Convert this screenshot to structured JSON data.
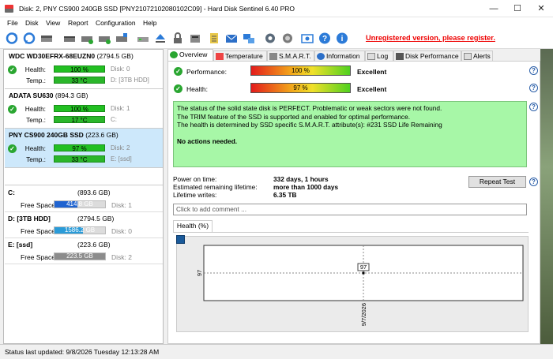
{
  "window": {
    "title": "Disk: 2, PNY CS900 240GB SSD [PNY21072102080102C09]  -  Hard Disk Sentinel 6.40 PRO",
    "minimize": "—",
    "maximize": "☐",
    "close": "✕"
  },
  "menu": [
    "File",
    "Disk",
    "View",
    "Report",
    "Configuration",
    "Help"
  ],
  "toolbar": {
    "icons": [
      "refresh-icon",
      "refresh-all-icon",
      "disk-scan-icon",
      "disk-test-icon",
      "health-icon",
      "eject-icon",
      "lock-icon",
      "device-icon",
      "report-icon",
      "mail-icon",
      "monitor-icon",
      "settings-icon",
      "sound-icon",
      "screenshot-icon",
      "help-icon",
      "info-icon"
    ],
    "unregistered": "Unregistered version, please register."
  },
  "disks": [
    {
      "name": "WDC WD30EFRX-68EUZN0",
      "size": "(2794.5 GB)",
      "health_label": "Health:",
      "health": "100 %",
      "health_pct": 100,
      "disk": "Disk: 0",
      "temp_label": "Temp.:",
      "temp": "33 °C",
      "vol": "D: [3TB HDD]"
    },
    {
      "name": "ADATA SU630",
      "size": "(894.3 GB)",
      "health_label": "Health:",
      "health": "100 %",
      "health_pct": 100,
      "disk": "Disk: 1",
      "temp_label": "Temp.:",
      "temp": "17 °C",
      "vol": "C:"
    },
    {
      "name": "PNY CS900 240GB SSD",
      "size": "(223.6 GB)",
      "health_label": "Health:",
      "health": "97 %",
      "health_pct": 97,
      "disk": "Disk: 2",
      "temp_label": "Temp.:",
      "temp": "33 °C",
      "vol": "E: [ssd]"
    }
  ],
  "volumes": [
    {
      "name": "C:",
      "size": "(893.6 GB)",
      "free_label": "Free Space",
      "free": "414.8 GB",
      "free_pct": 46,
      "disk": "Disk: 1",
      "color": "#1f63d0"
    },
    {
      "name": "D: [3TB HDD]",
      "size": "(2794.5 GB)",
      "free_label": "Free Space",
      "free": "1586.2 GB",
      "free_pct": 57,
      "disk": "Disk: 0",
      "color": "#2a9bd8"
    },
    {
      "name": "E: [ssd]",
      "size": "(223.6 GB)",
      "free_label": "Free Space",
      "free": "223.5 GB",
      "free_pct": 100,
      "disk": "Disk: 2",
      "color": "#8c8c8c"
    }
  ],
  "tabs": [
    "Overview",
    "Temperature",
    "S.M.A.R.T.",
    "Information",
    "Log",
    "Disk Performance",
    "Alerts"
  ],
  "overview": {
    "performance_label": "Performance:",
    "performance": "100 %",
    "performance_pct": 100,
    "performance_rating": "Excellent",
    "health_label": "Health:",
    "health": "97 %",
    "health_pct": 97,
    "health_rating": "Excellent",
    "status_lines": [
      "The status of the solid state disk is PERFECT. Problematic or weak sectors were not found.",
      "The TRIM feature of the SSD is supported and enabled for optimal performance.",
      "The health is determined by SSD specific S.M.A.R.T. attribute(s):  #231 SSD Life Remaining"
    ],
    "actions": "No actions needed.",
    "power_on_label": "Power on time:",
    "power_on": "332 days, 1 hours",
    "remaining_label": "Estimated remaining lifetime:",
    "remaining": "more than 1000 days",
    "writes_label": "Lifetime writes:",
    "writes": "6.35 TB",
    "repeat_test": "Repeat Test",
    "comment_placeholder": "Click to add comment ...",
    "health_tab": "Health (%)"
  },
  "chart_data": {
    "type": "line",
    "x": [
      "9/7/2026"
    ],
    "series": [
      {
        "values": [
          97
        ]
      }
    ],
    "ylabel_tick": "97",
    "point_label": "97",
    "xlabel_tick": "9/7/2026"
  },
  "statusbar": "Status last updated: 9/8/2026 Tuesday 12:13:28 AM"
}
